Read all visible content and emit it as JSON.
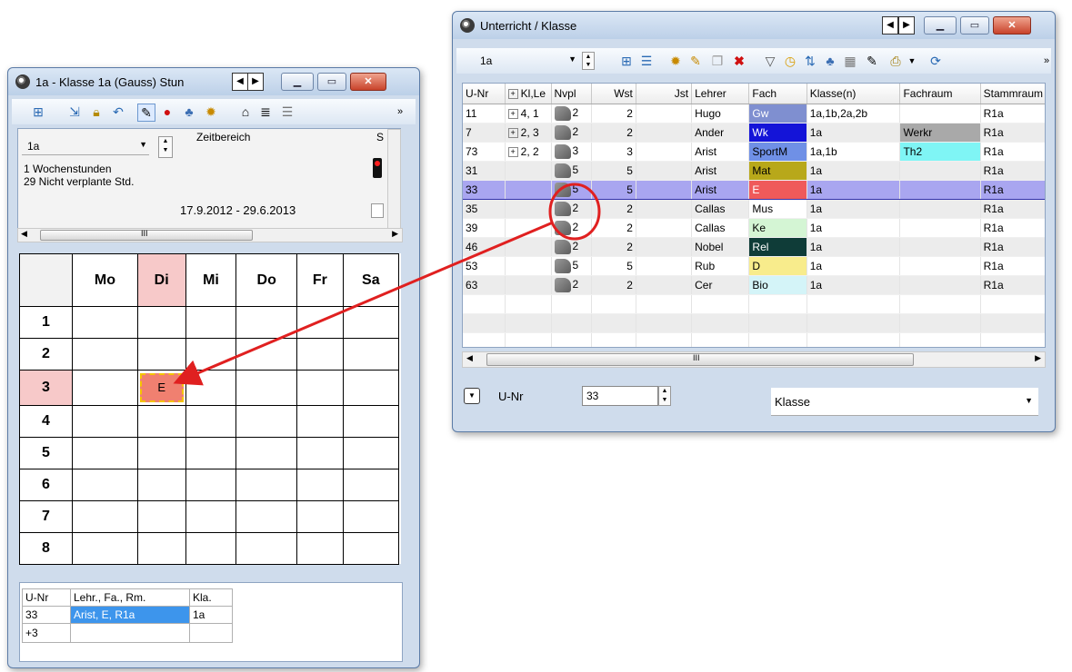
{
  "left_window": {
    "title": "1a - Klasse 1a (Gauss) Stun",
    "class_select": "1a",
    "info_line1": "1  Wochenstunden",
    "info_line2": "29  Nicht verplante Std.",
    "zeitbereich_label": "Zeitbereich",
    "zeitbereich_value": "17.9.2012 - 29.6.2013",
    "s_label": "S",
    "scroll_mid": "III",
    "days": [
      "Mo",
      "Di",
      "Mi",
      "Do",
      "Fr",
      "Sa"
    ],
    "periods": [
      "1",
      "2",
      "3",
      "4",
      "5",
      "6",
      "7",
      "8"
    ],
    "lesson_cell": "E",
    "bottom_headers": [
      "U-Nr",
      "Lehr., Fa., Rm.",
      "Kla."
    ],
    "bottom_rows": [
      [
        "33",
        "Arist, E, R1a",
        "1a"
      ],
      [
        "+3",
        "",
        ""
      ]
    ]
  },
  "right_window": {
    "title": "Unterricht / Klasse",
    "class_select": "1a",
    "columns": [
      "U-Nr",
      "Kl,Le",
      "Nvpl",
      "Wst",
      "Jst",
      "Lehrer",
      "Fach",
      "Klasse(n)",
      "Fachraum",
      "Stammraum"
    ],
    "rows": [
      {
        "unr": "11",
        "klle": "4, 1",
        "nvpl": "2",
        "wst": "2",
        "jst": "",
        "lehrer": "Hugo",
        "fach": "Gw",
        "fach_bg": "#7f8fd0",
        "fach_fg": "#ffffff",
        "klassen": "1a,1b,2a,2b",
        "fachraum": "",
        "fachraum_bg": "",
        "stammraum": "R1a"
      },
      {
        "unr": "7",
        "klle": "2, 3",
        "nvpl": "2",
        "wst": "2",
        "jst": "",
        "lehrer": "Ander",
        "fach": "Wk",
        "fach_bg": "#1414d8",
        "fach_fg": "#ffffff",
        "klassen": "1a",
        "fachraum": "Werkr",
        "fachraum_bg": "#a9a9a9",
        "stammraum": "R1a"
      },
      {
        "unr": "73",
        "klle": "2, 2",
        "nvpl": "3",
        "wst": "3",
        "jst": "",
        "lehrer": "Arist",
        "fach": "SportM",
        "fach_bg": "#6f90e6",
        "fach_fg": "#000000",
        "klassen": "1a,1b",
        "fachraum": "Th2",
        "fachraum_bg": "#7ff5f5",
        "stammraum": "R1a"
      },
      {
        "unr": "31",
        "klle": "",
        "nvpl": "5",
        "wst": "5",
        "jst": "",
        "lehrer": "Arist",
        "fach": "Mat",
        "fach_bg": "#b8a81a",
        "fach_fg": "#000000",
        "klassen": "1a",
        "fachraum": "",
        "fachraum_bg": "",
        "stammraum": "R1a"
      },
      {
        "unr": "33",
        "klle": "",
        "nvpl": "5",
        "wst": "5",
        "jst": "",
        "lehrer": "Arist",
        "fach": "E",
        "fach_bg": "#ef5a5a",
        "fach_fg": "#ffffff",
        "klassen": "1a",
        "fachraum": "",
        "fachraum_bg": "",
        "stammraum": "R1a"
      },
      {
        "unr": "35",
        "klle": "",
        "nvpl": "2",
        "wst": "2",
        "jst": "",
        "lehrer": "Callas",
        "fach": "Mus",
        "fach_bg": "#ffffff",
        "fach_fg": "#000000",
        "klassen": "1a",
        "fachraum": "",
        "fachraum_bg": "",
        "stammraum": "R1a"
      },
      {
        "unr": "39",
        "klle": "",
        "nvpl": "2",
        "wst": "2",
        "jst": "",
        "lehrer": "Callas",
        "fach": "Ke",
        "fach_bg": "#d4f5d4",
        "fach_fg": "#000000",
        "klassen": "1a",
        "fachraum": "",
        "fachraum_bg": "",
        "stammraum": "R1a"
      },
      {
        "unr": "46",
        "klle": "",
        "nvpl": "2",
        "wst": "2",
        "jst": "",
        "lehrer": "Nobel",
        "fach": "Rel",
        "fach_bg": "#0f3c38",
        "fach_fg": "#ffffff",
        "klassen": "1a",
        "fachraum": "",
        "fachraum_bg": "",
        "stammraum": "R1a"
      },
      {
        "unr": "53",
        "klle": "",
        "nvpl": "5",
        "wst": "5",
        "jst": "",
        "lehrer": "Rub",
        "fach": "D",
        "fach_bg": "#f8ec8c",
        "fach_fg": "#000000",
        "klassen": "1a",
        "fachraum": "",
        "fachraum_bg": "",
        "stammraum": "R1a"
      },
      {
        "unr": "63",
        "klle": "",
        "nvpl": "2",
        "wst": "2",
        "jst": "",
        "lehrer": "Cer",
        "fach": "Bio",
        "fach_bg": "#d4f4f8",
        "fach_fg": "#000000",
        "klassen": "1a",
        "fachraum": "",
        "fachraum_bg": "",
        "stammraum": "R1a"
      }
    ],
    "selected_unr": "33",
    "scroll_mid": "III",
    "footer_label": "U-Nr",
    "footer_value": "33",
    "footer_select": "Klasse"
  },
  "colors": {
    "highlight_col": "#f7c9c9",
    "lesson_bg": "#f08070",
    "annotation": "#e02020",
    "selected_row": "#a9a6f0"
  },
  "icons": [
    "clock-app-icon",
    "maximize-icon",
    "minimize-icon",
    "close-icon",
    "prev-arrow-icon",
    "next-arrow-icon"
  ]
}
